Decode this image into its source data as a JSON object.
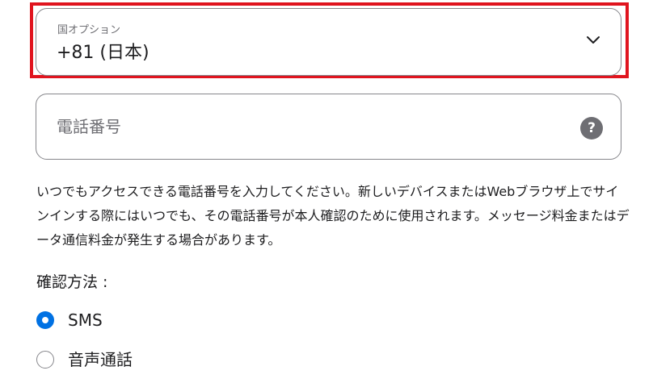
{
  "country_select": {
    "label": "国オプション",
    "value": "+81 (日本)",
    "icon": "chevron-down-icon"
  },
  "phone_field": {
    "placeholder": "電話番号",
    "help_label": "?"
  },
  "description": "いつでもアクセスできる電話番号を入力してください。新しいデバイスまたはWebブラウザ上でサインインする際にはいつでも、その電話番号が本人確認のために使用されます。メッセージ料金またはデータ通信料金が発生する場合があります。",
  "verification": {
    "heading": "確認方法 :",
    "options": [
      {
        "label": "SMS",
        "selected": true
      },
      {
        "label": "音声通話",
        "selected": false
      }
    ]
  },
  "colors": {
    "accent": "#0071e3",
    "highlight": "#e0141e",
    "border": "#86868b",
    "secondary_text": "#6e6e73"
  }
}
